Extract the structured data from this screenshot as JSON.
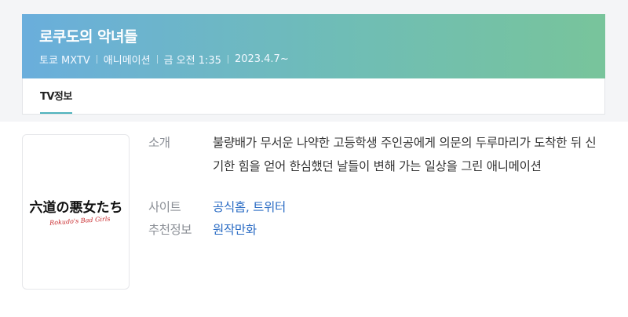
{
  "header": {
    "title": "로쿠도의 악녀들",
    "channel": "토쿄 MXTV",
    "genre": "애니메이션",
    "schedule": "금 오전 1:35",
    "start_date": "2023.4.7~"
  },
  "tabs": [
    {
      "label": "TV정보",
      "active": true
    }
  ],
  "poster": {
    "logo_text": "六道の悪女たち",
    "logo_subtext": "Rokudo's Bad Girls"
  },
  "info": {
    "intro_label": "소개",
    "intro_text": "불량배가 무서운 나약한 고등학생 주인공에게 의문의 두루마리가 도착한 뒤 신기한 힘을 얻어 한심했던 날들이 변해 가는 일상을 그린 애니메이션",
    "site_label": "사이트",
    "site_links": "공식홈, 트위터",
    "recommend_label": "추천정보",
    "recommend_value": "원작만화"
  },
  "colors": {
    "header_gradient_start": "#6aaedc",
    "header_gradient_end": "#78c49b",
    "tab_underline": "#4fb2bd",
    "link": "#2b6cc4"
  }
}
